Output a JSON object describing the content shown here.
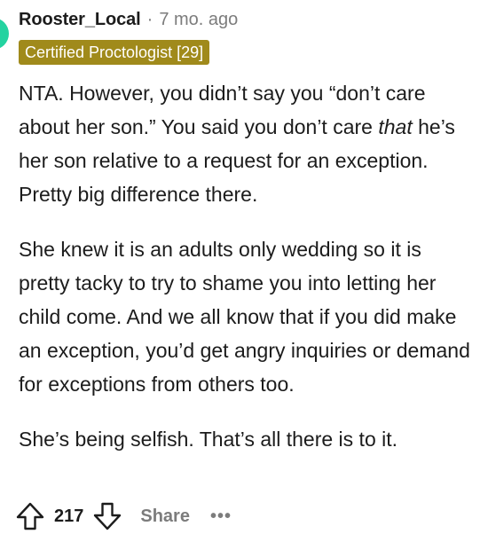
{
  "comment": {
    "author": "Rooster_Local",
    "separator": "·",
    "age": "7 mo. ago",
    "flair": "Certified Proctologist [29]",
    "paragraph_1_before_italic": "NTA. However, you didn’t say you “don’t care about her son.” You said you don’t care ",
    "paragraph_1_italic": "that",
    "paragraph_1_after_italic": " he’s her son relative to a request for an exception. Pretty big difference there.",
    "paragraph_2": "She knew it is an adults only wedding so it is pretty tacky to try to shame you into letting her child come. And we all know that if you did make an exception, you’d get angry inquiries or demand for exceptions from others too.",
    "paragraph_3": "She’s being selfish. That’s all there is to it."
  },
  "actions": {
    "score": "217",
    "share_label": "Share",
    "more_label": "•••",
    "icons": [
      "upvote-arrow-icon",
      "downvote-arrow-icon",
      "more-dots-icon"
    ]
  },
  "colors": {
    "avatar": "#24d3a0",
    "flair_background": "#a08a1b",
    "flair_text": "#ffffff",
    "muted_text": "#7c7c7c",
    "body_text": "#1c1c1c"
  }
}
